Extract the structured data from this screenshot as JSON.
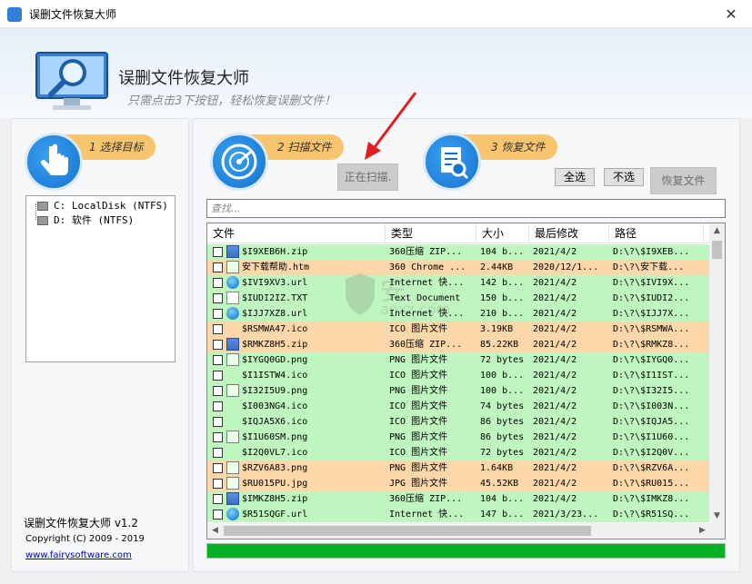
{
  "window": {
    "title": "误删文件恢复大师",
    "close_glyph": "✕"
  },
  "banner": {
    "app_name": "误删文件恢复大师",
    "slogan": "只需点击3下按钮，轻松恢复误删文件！"
  },
  "steps": [
    {
      "label": "1 选择目标"
    },
    {
      "label": "2 扫描文件"
    },
    {
      "label": "3 恢复文件"
    }
  ],
  "tree": [
    {
      "label": "C: LocalDisk (NTFS)"
    },
    {
      "label": "D: 软件 (NTFS)"
    }
  ],
  "buttons": {
    "scanning": "正在扫描.",
    "select_all": "全选",
    "select_none": "不选",
    "recover": "恢复文件"
  },
  "search": {
    "placeholder": "查找..."
  },
  "columns": [
    "文件",
    "类型",
    "大小",
    "最后修改",
    "路径"
  ],
  "rows": [
    {
      "name": "$I9XEB6H.zip",
      "type": "360压缩 ZIP...",
      "size": "104 b...",
      "modified": "2021/4/2",
      "path": "D:\\?\\$I9XEB...",
      "color": "green",
      "icon": "zip"
    },
    {
      "name": "安下载帮助.htm",
      "type": "360 Chrome ...",
      "size": "2.44KB",
      "modified": "2020/12/1...",
      "path": "D:\\?\\安下载...",
      "color": "orange",
      "icon": "img"
    },
    {
      "name": "$IVI9XV3.url",
      "type": "Internet 快...",
      "size": "142 b...",
      "modified": "2021/4/2",
      "path": "D:\\?\\$IVI9X...",
      "color": "green",
      "icon": "web"
    },
    {
      "name": "$IUDI2IZ.TXT",
      "type": "Text Document",
      "size": "150 b...",
      "modified": "2021/4/2",
      "path": "D:\\?\\$IUDI2...",
      "color": "green",
      "icon": "doc"
    },
    {
      "name": "$IJJ7XZ8.url",
      "type": "Internet 快...",
      "size": "210 b...",
      "modified": "2021/4/2",
      "path": "D:\\?\\$IJJ7X...",
      "color": "green",
      "icon": "web"
    },
    {
      "name": "$RSMWA47.ico",
      "type": "ICO 图片文件",
      "size": "3.19KB",
      "modified": "2021/4/2",
      "path": "D:\\?\\$RSMWA...",
      "color": "orange",
      "icon": "ico"
    },
    {
      "name": "$RMKZ8H5.zip",
      "type": "360压缩 ZIP...",
      "size": "85.22KB",
      "modified": "2021/4/2",
      "path": "D:\\?\\$RMKZ8...",
      "color": "orange",
      "icon": "zip"
    },
    {
      "name": "$IYGQ0GD.png",
      "type": "PNG 图片文件",
      "size": "72 bytes",
      "modified": "2021/4/2",
      "path": "D:\\?\\$IYGQ0...",
      "color": "green",
      "icon": "img"
    },
    {
      "name": "$I1ISTW4.ico",
      "type": "ICO 图片文件",
      "size": "100 b...",
      "modified": "2021/4/2",
      "path": "D:\\?\\$I1IST...",
      "color": "green",
      "icon": "ico"
    },
    {
      "name": "$I32I5U9.png",
      "type": "PNG 图片文件",
      "size": "100 b...",
      "modified": "2021/4/2",
      "path": "D:\\?\\$I32I5...",
      "color": "green",
      "icon": "img"
    },
    {
      "name": "$I003NG4.ico",
      "type": "ICO 图片文件",
      "size": "74 bytes",
      "modified": "2021/4/2",
      "path": "D:\\?\\$I003N...",
      "color": "green",
      "icon": "ico"
    },
    {
      "name": "$IQJA5X6.ico",
      "type": "ICO 图片文件",
      "size": "86 bytes",
      "modified": "2021/4/2",
      "path": "D:\\?\\$IQJA5...",
      "color": "green",
      "icon": "ico"
    },
    {
      "name": "$I1U60SM.png",
      "type": "PNG 图片文件",
      "size": "86 bytes",
      "modified": "2021/4/2",
      "path": "D:\\?\\$I1U60...",
      "color": "green",
      "icon": "img"
    },
    {
      "name": "$I2Q0VL7.ico",
      "type": "ICO 图片文件",
      "size": "72 bytes",
      "modified": "2021/4/2",
      "path": "D:\\?\\$I2Q0V...",
      "color": "green",
      "icon": "ico"
    },
    {
      "name": "$RZV6A83.png",
      "type": "PNG 图片文件",
      "size": "1.64KB",
      "modified": "2021/4/2",
      "path": "D:\\?\\$RZV6A...",
      "color": "orange",
      "icon": "img"
    },
    {
      "name": "$RU015PU.jpg",
      "type": "JPG 图片文件",
      "size": "45.52KB",
      "modified": "2021/4/2",
      "path": "D:\\?\\$RU015...",
      "color": "orange",
      "icon": "img"
    },
    {
      "name": "$IMKZ8H5.zip",
      "type": "360压缩 ZIP...",
      "size": "104 b...",
      "modified": "2021/4/2",
      "path": "D:\\?\\$IMKZ8...",
      "color": "green",
      "icon": "zip"
    },
    {
      "name": "$R51SQGF.url",
      "type": "Internet 快...",
      "size": "147 b...",
      "modified": "2021/3/23...",
      "path": "D:\\?\\$R51SQ...",
      "color": "green",
      "icon": "web"
    }
  ],
  "progress": {
    "fraction": 1.0,
    "color": "#06b025"
  },
  "about": {
    "name": "误删文件恢复大师 v1.2",
    "copyright": "Copyright (C) 2009 - 2019",
    "link": "www.fairysoftware.com"
  },
  "watermark": {
    "text": "安",
    "sub": "anxz.com"
  },
  "colors": {
    "row_green": "#bff5bf",
    "row_orange": "#fcd7a9",
    "step_pill": "#f8c46e",
    "step_circle": "#1473d0"
  }
}
